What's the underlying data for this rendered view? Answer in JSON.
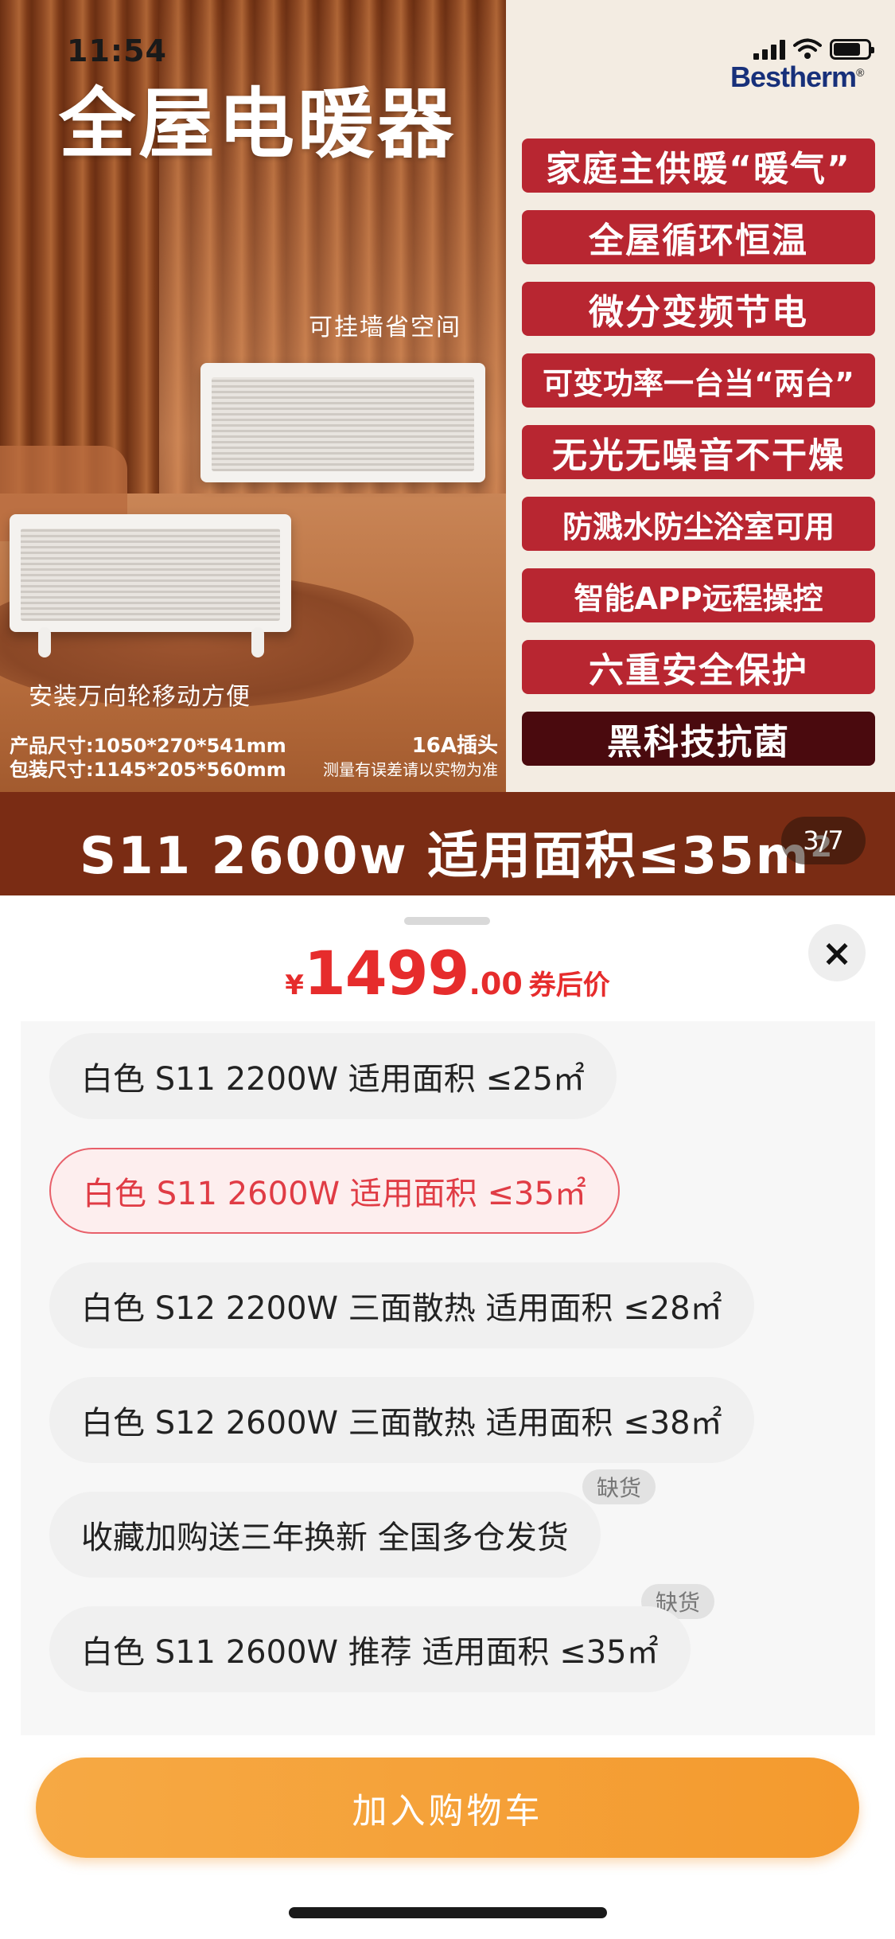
{
  "status_bar": {
    "time": "11:54"
  },
  "hero": {
    "title": "全屋电暖器",
    "brand": "Bestherm",
    "brand_mark": "®",
    "wall_label": "可挂墙省空间",
    "wheel_label": "安装万向轮移动方便",
    "product_size": "产品尺寸:1050*270*541mm",
    "package_size": "包装尺寸:1145*205*560mm",
    "plug": "16A插头",
    "measure_note": "测量有误差请以实物为准",
    "features": [
      "家庭主供暖“暖气”",
      "全屋循环恒温",
      "微分变频节电",
      "可变功率一台当“两台”",
      "无光无噪音不干燥",
      "防溅水防尘浴室可用",
      "智能APP远程操控",
      "六重安全保护",
      "黑科技抗菌"
    ],
    "model_banner": "S11 2600w    适用面积≤35m²",
    "page_indicator": "3/7"
  },
  "sheet": {
    "close_icon": "×",
    "price": {
      "currency": "¥",
      "integer": "1499",
      "decimal": ".00",
      "label": "券后价"
    },
    "options": [
      {
        "label": "白色 S11  2200W 适用面积 ≤25㎡"
      },
      {
        "label": "白色 S11 2600W 适用面积 ≤35㎡"
      },
      {
        "label": "白色 S12 2200W 三面散热 适用面积 ≤28㎡"
      },
      {
        "label": "白色 S12 2600W 三面散热 适用面积 ≤38㎡"
      },
      {
        "label": "收藏加购送三年换新 全国多仓发货"
      },
      {
        "label": "白色 S11 2600W  推荐 适用面积 ≤35㎡"
      }
    ],
    "selected_option": 1,
    "out_of_stock_badge": "缺货",
    "add_to_cart": "加入购物车"
  },
  "colors": {
    "feature_red": "#b82631",
    "feature_dark": "#4a0a0e",
    "price_red": "#e62c2c",
    "selected_border": "#e8606a",
    "cart_orange": "#f49a2e"
  }
}
